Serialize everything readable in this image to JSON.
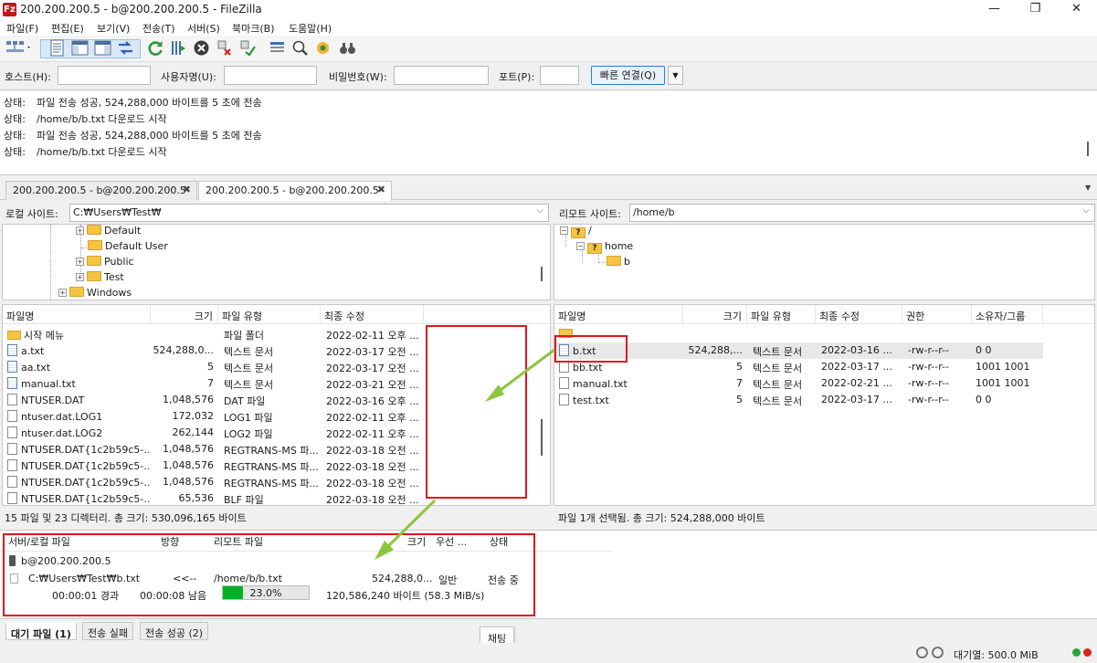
{
  "window": {
    "app_icon_text": "Fz",
    "title": "200.200.200.5 - b@200.200.200.5 - FileZilla",
    "minimize_glyph": "—",
    "maximize_glyph": "❐",
    "close_glyph": "✕"
  },
  "menu": [
    "파일(F)",
    "편집(E)",
    "보기(V)",
    "전송(T)",
    "서버(S)",
    "북마크(B)",
    "도움말(H)"
  ],
  "toolbar_icons": [
    "site-manager-icon",
    "view-message-log-icon",
    "view-local-tree-icon",
    "view-remote-tree-icon",
    "view-queue-icon",
    "refresh-icon",
    "process-queue-icon",
    "cancel-icon",
    "disconnect-icon",
    "reconnect-icon",
    "directory-filter-icon",
    "compare-icon",
    "sync-browse-icon",
    "search-icon"
  ],
  "quickconnect": {
    "host_label": "호스트(H):",
    "user_label": "사용자명(U):",
    "pass_label": "비밀번호(W):",
    "port_label": "포트(P):",
    "host_value": "",
    "user_value": "",
    "pass_value": "",
    "port_value": "",
    "button_label": "빠른 연결(Q)",
    "dropdown_glyph": "▼"
  },
  "log": [
    {
      "label": "상태:",
      "text": "파일 전송 성공, 524,288,000 바이트를 5 초에 전송"
    },
    {
      "label": "상태:",
      "text": "/home/b/b.txt 다운로드 시작"
    },
    {
      "label": "상태:",
      "text": "파일 전송 성공, 524,288,000 바이트를 5 초에 전송"
    },
    {
      "label": "상태:",
      "text": "/home/b/b.txt 다운로드 시작"
    }
  ],
  "tabs": [
    {
      "label": "200.200.200.5 - b@200.200.200.5",
      "active": false
    },
    {
      "label": "200.200.200.5 - b@200.200.200.5",
      "active": true
    }
  ],
  "tab_close_glyph": "✖",
  "tabbar_menu_glyph": "▼",
  "local": {
    "site_label": "로컬 사이트:",
    "path": "C:₩Users₩Test₩",
    "tree": [
      {
        "name": "Default",
        "level": 1
      },
      {
        "name": "Default User",
        "level": 1
      },
      {
        "name": "Public",
        "level": 1
      },
      {
        "name": "Test",
        "level": 1
      },
      {
        "name": "Windows",
        "level": 0
      }
    ],
    "columns": [
      "파일명",
      "크기",
      "파일 유형",
      "최종 수정"
    ],
    "files": [
      {
        "name": "시작 메뉴",
        "size": "",
        "type": "파일 폴더",
        "modified": "2022-02-11 오후 ...",
        "icon": "folder"
      },
      {
        "name": "a.txt",
        "size": "524,288,0...",
        "type": "텍스트 문서",
        "modified": "2022-03-17 오전 ...",
        "icon": "txt"
      },
      {
        "name": "aa.txt",
        "size": "5",
        "type": "텍스트 문서",
        "modified": "2022-03-17 오전 ...",
        "icon": "txt"
      },
      {
        "name": "manual.txt",
        "size": "7",
        "type": "텍스트 문서",
        "modified": "2022-03-21 오전 ...",
        "icon": "txt"
      },
      {
        "name": "NTUSER.DAT",
        "size": "1,048,576",
        "type": "DAT 파일",
        "modified": "2022-03-16 오후 ...",
        "icon": "file"
      },
      {
        "name": "ntuser.dat.LOG1",
        "size": "172,032",
        "type": "LOG1 파일",
        "modified": "2022-02-11 오후 ...",
        "icon": "file"
      },
      {
        "name": "ntuser.dat.LOG2",
        "size": "262,144",
        "type": "LOG2 파일",
        "modified": "2022-02-11 오후 ...",
        "icon": "file"
      },
      {
        "name": "NTUSER.DAT{1c2b59c5-...",
        "size": "1,048,576",
        "type": "REGTRANS-MS 파...",
        "modified": "2022-03-18 오전 ...",
        "icon": "file"
      },
      {
        "name": "NTUSER.DAT{1c2b59c5-...",
        "size": "1,048,576",
        "type": "REGTRANS-MS 파...",
        "modified": "2022-03-18 오전 ...",
        "icon": "file"
      },
      {
        "name": "NTUSER.DAT{1c2b59c5-...",
        "size": "1,048,576",
        "type": "REGTRANS-MS 파...",
        "modified": "2022-03-18 오전 ...",
        "icon": "file"
      },
      {
        "name": "NTUSER.DAT{1c2b59c5-...",
        "size": "65,536",
        "type": "BLF 파일",
        "modified": "2022-03-18 오전 ...",
        "icon": "file"
      }
    ],
    "status": "15 파일 및 23 디렉터리. 총 크기: 530,096,165 바이트"
  },
  "remote": {
    "site_label": "리모트 사이트:",
    "path": "/home/b",
    "tree": [
      {
        "name": "/",
        "level": 0
      },
      {
        "name": "home",
        "level": 1
      },
      {
        "name": "b",
        "level": 2
      }
    ],
    "columns": [
      "파일명",
      "크기",
      "파일 유형",
      "최종 수정",
      "권한",
      "소유자/그룹"
    ],
    "files": [
      {
        "name": "",
        "size": "",
        "type": "",
        "modified": "",
        "perm": "",
        "owner": "",
        "icon": "folder"
      },
      {
        "name": "b.txt",
        "size": "524,288,...",
        "type": "텍스트 문서",
        "modified": "2022-03-16 ...",
        "perm": "-rw-r--r--",
        "owner": "0 0",
        "icon": "txt"
      },
      {
        "name": "bb.txt",
        "size": "5",
        "type": "텍스트 문서",
        "modified": "2022-03-17 ...",
        "perm": "-rw-r--r--",
        "owner": "1001 1001",
        "icon": "file"
      },
      {
        "name": "manual.txt",
        "size": "7",
        "type": "텍스트 문서",
        "modified": "2022-02-21 ...",
        "perm": "-rw-r--r--",
        "owner": "1001 1001",
        "icon": "file"
      },
      {
        "name": "test.txt",
        "size": "5",
        "type": "텍스트 문서",
        "modified": "2022-03-17 ...",
        "perm": "-rw-r--r--",
        "owner": "0 0",
        "icon": "file"
      }
    ],
    "status": "파일 1개 선택됨. 총 크기: 524,288,000 바이트"
  },
  "queue": {
    "columns": [
      "서버/로컬 파일",
      "방향",
      "리모트 파일",
      "크기",
      "우선 ...",
      "상태"
    ],
    "server": "b@200.200.200.5",
    "local_file": "C:₩Users₩Test₩b.txt",
    "direction": "<<--",
    "remote_file": "/home/b/b.txt",
    "size": "524,288,0...",
    "priority": "일반",
    "state": "전송 중",
    "elapsed": "00:00:01 경과",
    "remaining": "00:00:08 남음",
    "progress": 0.23,
    "progress_text": "23.0%",
    "transferred": "120,586,240 바이트 (58.3 MiB/s)"
  },
  "queue_tabs": [
    "대기 파일 (1)",
    "전송 실패",
    "전송 성공 (2)"
  ],
  "tooltip": "채팅",
  "statusbar": {
    "queue_text": "대기열: 500.0 MiB"
  },
  "colors": {
    "annotation_red": "#e0151c",
    "annotation_arrow": "#8cc63f",
    "progress_green": "#06b025"
  }
}
